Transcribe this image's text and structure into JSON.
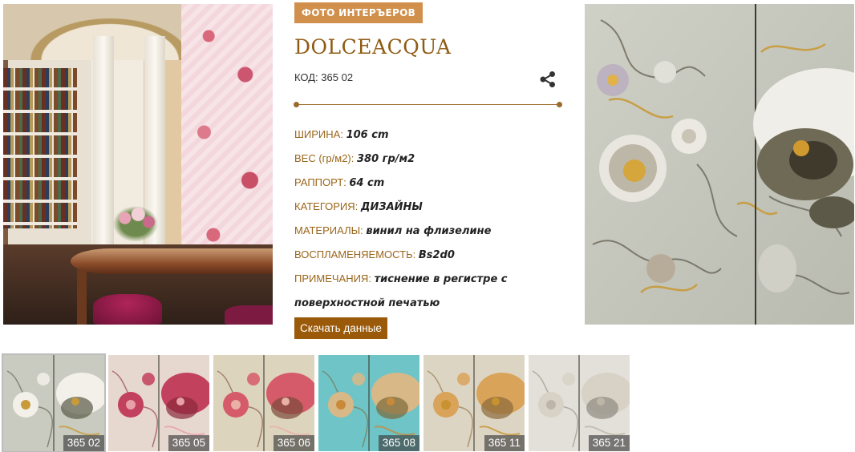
{
  "badge": "ФОТО ИНТЕРЪЕРОВ",
  "product": {
    "title": "DOLCEACQUA",
    "code_label": "КОД:",
    "code_value": "365 02"
  },
  "specs": [
    {
      "label": "ШИРИНА:",
      "value": "106 cm"
    },
    {
      "label": "ВЕС (гр/м2):",
      "value": "380 гр/м2"
    },
    {
      "label": "РАППОРТ:",
      "value": "64 cm"
    },
    {
      "label": "КАТЕГОРИЯ:",
      "value": "ДИЗАЙНЫ"
    },
    {
      "label": "МАТЕРИАЛЫ:",
      "value": "винил на флизелине"
    },
    {
      "label": "ВОСПЛАМЕНЯЕМОСТЬ:",
      "value": "Bs2d0"
    },
    {
      "label": "ПРИМЕЧАНИЯ:",
      "value": "тиснение в регистре с поверхностной печатью"
    }
  ],
  "download_label": "Скачать данные",
  "icons": {
    "share": "share-icon"
  },
  "colors": {
    "accent": "#9a5a0a",
    "badge": "#d0904c",
    "title": "#8f5a12",
    "label": "#9a6519"
  },
  "thumbnails": [
    {
      "code": "365 02",
      "base": "#c9cbc0",
      "flower": "#f2f0e8",
      "accent": "#c79a3a",
      "dark": "#5a5a48",
      "active": true
    },
    {
      "code": "365 05",
      "base": "#e6d8cf",
      "flower": "#c2415d",
      "accent": "#e8a0a8",
      "dark": "#8a2a3a",
      "active": false
    },
    {
      "code": "365 06",
      "base": "#ddd4bd",
      "flower": "#d65b6a",
      "accent": "#e9b0a8",
      "dark": "#7a4a3a",
      "active": false
    },
    {
      "code": "365 08",
      "base": "#6ec4c7",
      "flower": "#d9b887",
      "accent": "#c88a3a",
      "dark": "#7a6a3a",
      "active": false
    },
    {
      "code": "365 11",
      "base": "#ddd5c4",
      "flower": "#d9a35a",
      "accent": "#c8922e",
      "dark": "#8a6a3a",
      "active": false
    },
    {
      "code": "365 21",
      "base": "#e3e0d9",
      "flower": "#d8d2c6",
      "accent": "#bdb6a8",
      "dark": "#8f8a80",
      "active": false
    }
  ]
}
